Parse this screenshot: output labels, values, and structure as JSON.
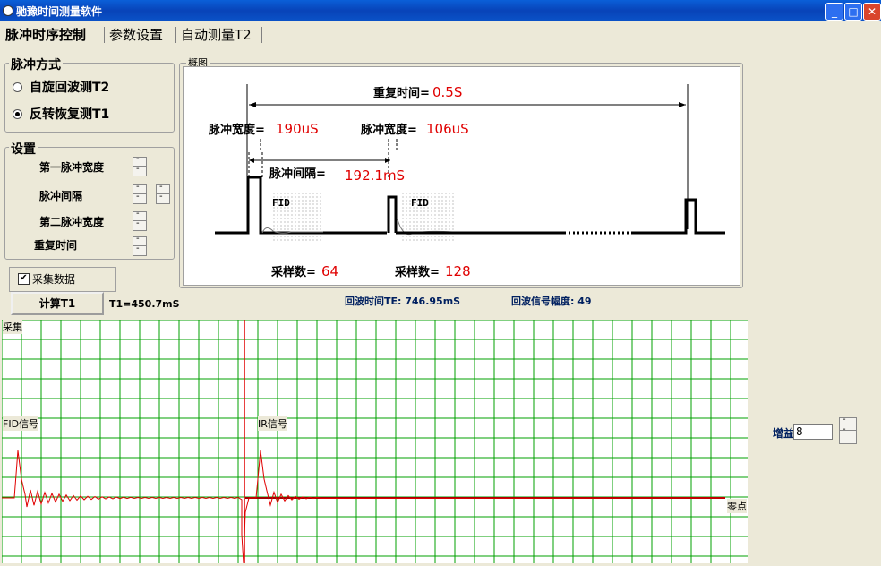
{
  "window": {
    "title": "驰豫时间测量软件"
  },
  "tabs": [
    {
      "label": "脉冲时序控制"
    },
    {
      "label": "参数设置"
    },
    {
      "label": "自动测量T2"
    }
  ],
  "pulse_mode": {
    "title": "脉冲方式",
    "options": [
      {
        "label": "自旋回波测T2",
        "selected": false
      },
      {
        "label": "反转恢复测T1",
        "selected": true
      }
    ]
  },
  "settings": {
    "title": "设置",
    "items": [
      "第一脉冲宽度",
      "脉冲间隔",
      "第二脉冲宽度",
      "重复时间"
    ]
  },
  "diagram": {
    "title": "概图",
    "repeat_label": "重复时间=",
    "repeat_value": "0.5S",
    "pulse1_label": "脉冲宽度=",
    "pulse1_value": "190uS",
    "pulse2_label": "脉冲宽度=",
    "pulse2_value": "106uS",
    "interval_label": "脉冲间隔=",
    "interval_value": "192.1mS",
    "fid1": "FID",
    "fid2": "FID",
    "samples1_label": "采样数=",
    "samples1_value": "64",
    "samples2_label": "采样数=",
    "samples2_value": "128"
  },
  "collect": {
    "label": "采集数据",
    "checked": true
  },
  "calc_button": "计算T1",
  "t1_result": "T1=450.7mS",
  "echo_time": "回波时间TE: 746.95mS",
  "echo_amp": "回波信号幅度: 49",
  "scope": {
    "label_collect": "采集",
    "label_fid": "FID信号",
    "label_ir": "IR信号",
    "label_zero": "零点"
  },
  "gain": {
    "label": "增益",
    "value": "8"
  },
  "colors": {
    "grid": "#00a000",
    "signal": "#e00000",
    "titlebar": "#0a53c8"
  }
}
